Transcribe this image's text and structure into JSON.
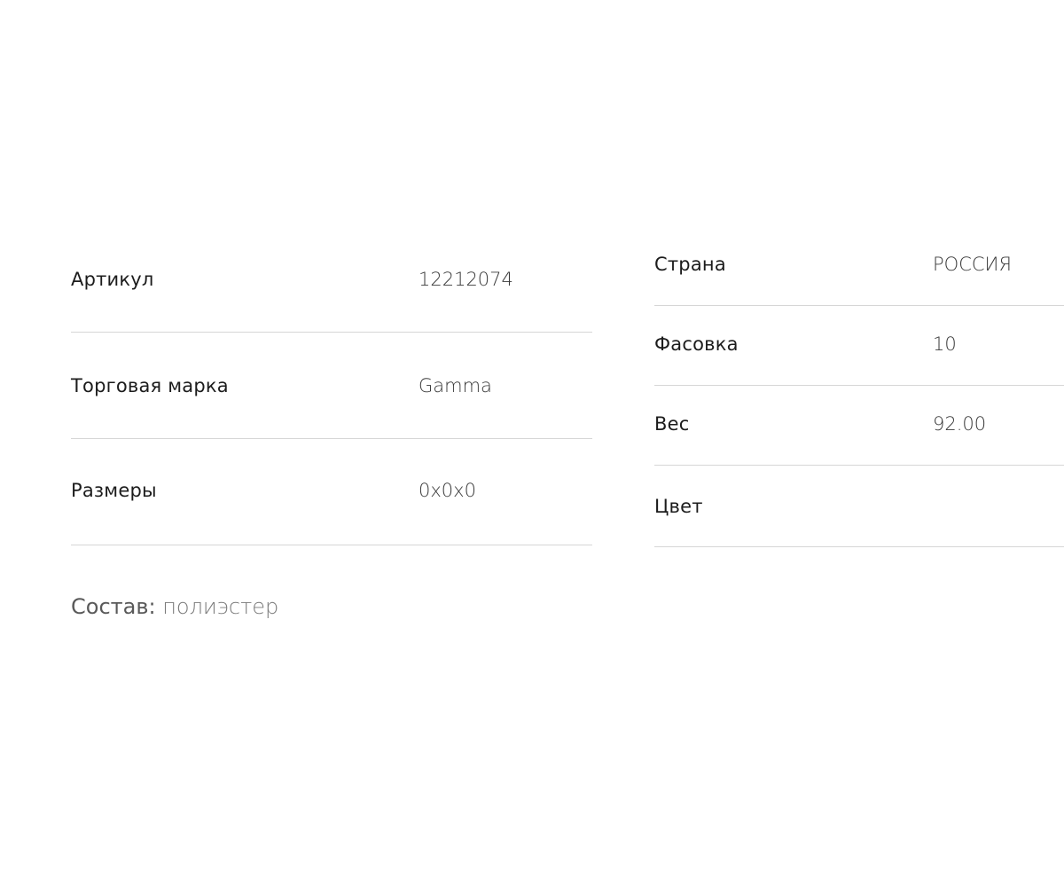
{
  "specs_left": [
    {
      "label": "Артикул",
      "value": "12212074"
    },
    {
      "label": "Торговая марка",
      "value": "Gamma"
    },
    {
      "label": "Размеры",
      "value": "0x0x0"
    }
  ],
  "specs_right": [
    {
      "label": "Страна",
      "value": "РОССИЯ"
    },
    {
      "label": "Фасовка",
      "value": "10"
    },
    {
      "label": "Вес",
      "value": "92.00"
    },
    {
      "label": "Цвет",
      "value": ""
    }
  ],
  "composition": {
    "label": "Состав:",
    "value": "полиэстер"
  },
  "colors": {
    "divider": "#d6d6d6",
    "label": "#1c1c1c",
    "value": "#3a3a3a",
    "composition": "#6a6a6a"
  }
}
